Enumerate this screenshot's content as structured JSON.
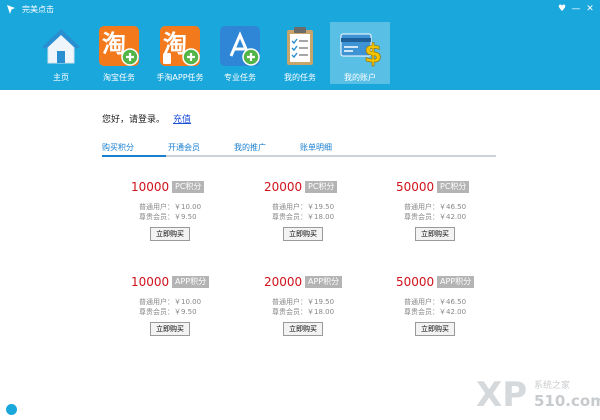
{
  "window": {
    "title": "完美点击",
    "controls": {
      "menu": "♥",
      "minimize": "—",
      "close": "✕"
    }
  },
  "nav": {
    "items": [
      {
        "label": "主页",
        "icon": "home-icon"
      },
      {
        "label": "淘宝任务",
        "icon": "taobao-icon"
      },
      {
        "label": "手淘APP任务",
        "icon": "mobile-taobao-icon"
      },
      {
        "label": "专业任务",
        "icon": "app-store-icon"
      },
      {
        "label": "我的任务",
        "icon": "clipboard-icon"
      },
      {
        "label": "我的账户",
        "icon": "account-card-icon"
      }
    ],
    "active_index": 5
  },
  "greeting": {
    "text": "您好，请登录。",
    "link": "充值"
  },
  "tabs": [
    "购买积分",
    "开通会员",
    "我的推广",
    "账单明细"
  ],
  "active_tab": 0,
  "labels": {
    "normal_user": "普通用户：￥",
    "vip_user": "尊贵会员：￥",
    "buy": "立即购买"
  },
  "cards": [
    {
      "amount": "10000",
      "type": "PC积分",
      "normal_price": "10.00",
      "vip_price": "9.50"
    },
    {
      "amount": "20000",
      "type": "PC积分",
      "normal_price": "19.50",
      "vip_price": "18.00"
    },
    {
      "amount": "50000",
      "type": "PC积分",
      "normal_price": "46.50",
      "vip_price": "42.00"
    },
    {
      "amount": "10000",
      "type": "APP积分",
      "normal_price": "10.00",
      "vip_price": "9.50"
    },
    {
      "amount": "20000",
      "type": "APP积分",
      "normal_price": "19.50",
      "vip_price": "18.00"
    },
    {
      "amount": "50000",
      "type": "APP积分",
      "normal_price": "46.50",
      "vip_price": "42.00"
    }
  ],
  "watermark": {
    "logo": "XP",
    "text": "系统之家",
    "domain": "510.com"
  },
  "colors": {
    "header": "#1aa7dc",
    "accent": "#1a7fcf",
    "price_red": "#d0121b",
    "badge": "#b4b4b4"
  }
}
